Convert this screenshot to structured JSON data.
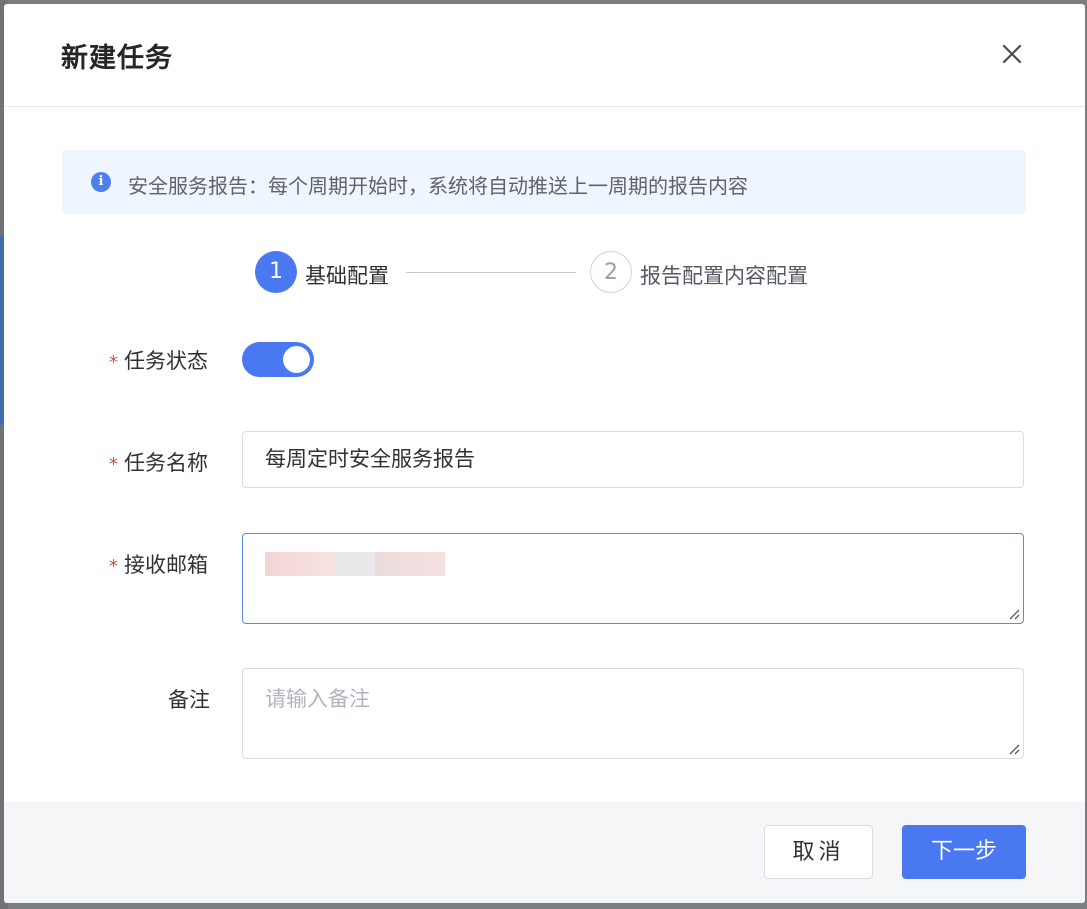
{
  "dialog": {
    "title": "新建任务",
    "close_icon": "close-icon"
  },
  "alert": {
    "icon": "info-icon",
    "icon_glyph": "i",
    "text": "安全服务报告：每个周期开始时，系统将自动推送上一周期的报告内容"
  },
  "steps": [
    {
      "number": "1",
      "label": "基础配置",
      "active": true
    },
    {
      "number": "2",
      "label": "报告配置内容配置",
      "active": false
    }
  ],
  "form": {
    "required_mark": "*",
    "status_label": "任务状态",
    "status_on": true,
    "name_label": "任务名称",
    "name_value": "每周定时安全服务报告",
    "email_label": "接收邮箱",
    "email_value_redacted": true,
    "note_label": "备注",
    "note_placeholder": "请输入备注"
  },
  "footer": {
    "cancel_label": "取消",
    "next_label": "下一步"
  },
  "colors": {
    "primary": "#4a78f0",
    "required": "#e04848",
    "alert_bg": "#f0f6ff"
  }
}
